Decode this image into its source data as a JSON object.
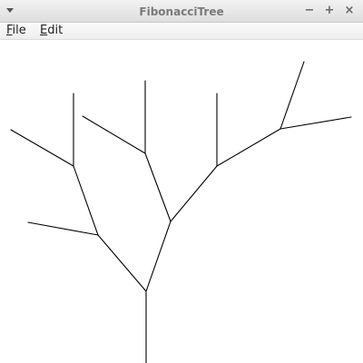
{
  "window": {
    "title": "FibonacciTree",
    "minimize_label": "−",
    "maximize_label": "+",
    "close_label": "×"
  },
  "menubar": {
    "items": [
      {
        "label": "File",
        "mnemonic": "F",
        "rest": "ile"
      },
      {
        "label": "Edit",
        "mnemonic": "E",
        "rest": "dit"
      }
    ]
  },
  "icons": {
    "window_menu": "chevron-down-icon"
  },
  "colors": {
    "tree_stroke": "#000000",
    "background": "#ffffff"
  }
}
